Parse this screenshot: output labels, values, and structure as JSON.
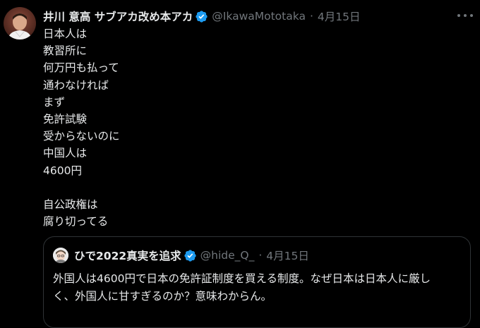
{
  "tweet": {
    "author_name": "井川 意高 サブアカ改め本アカ",
    "handle": "@IkawaMototaka",
    "separator": "·",
    "date": "4月15日",
    "body_lines": [
      "日本人は",
      "教習所に",
      "何万円も払って",
      "通わなければ",
      "まず",
      "免許試験",
      "受からないのに",
      "中国人は",
      "4600円",
      "",
      "自公政権は",
      "腐り切ってる"
    ]
  },
  "quoted_tweet": {
    "author_name": "ひで2022真実を追求",
    "handle": "@hide_Q_",
    "separator": "·",
    "date": "4月15日",
    "body_lines": [
      "外国人は4600円で日本の免許証制度を買える制度。なぜ日本は日本人に厳し",
      "く、外国人に甘すぎるのか？意味わからん。"
    ]
  },
  "colors": {
    "background": "#000000",
    "primary_text": "#e7e9ea",
    "secondary_text": "#71767b",
    "verified_blue": "#1d9bf0",
    "border": "#2f3336"
  },
  "icons": {
    "verified": "verified-badge-icon",
    "more": "more-options-icon"
  }
}
